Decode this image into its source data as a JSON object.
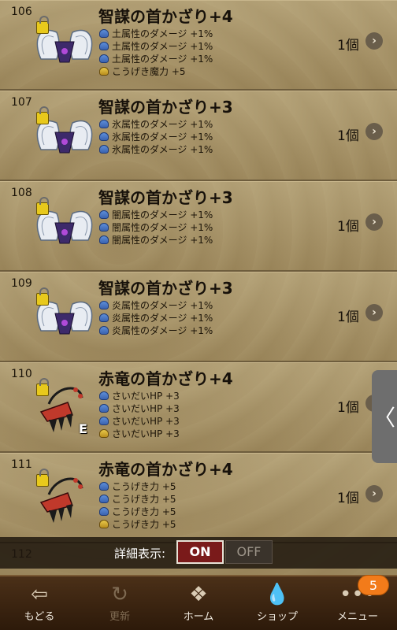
{
  "items": [
    {
      "num": "106",
      "name": "智謀の首かざり+4",
      "type": "wings",
      "equipped": false,
      "stats": [
        {
          "text": "土属性のダメージ +1%",
          "icon": "blue-slime-icon"
        },
        {
          "text": "土属性のダメージ +1%",
          "icon": "blue-slime-icon"
        },
        {
          "text": "土属性のダメージ +1%",
          "icon": "blue-slime-icon"
        },
        {
          "text": "こうげき魔力 +5",
          "icon": "gold-slime-icon"
        }
      ],
      "count": "1個"
    },
    {
      "num": "107",
      "name": "智謀の首かざり+3",
      "type": "wings",
      "equipped": false,
      "stats": [
        {
          "text": "氷属性のダメージ +1%",
          "icon": "blue-slime-icon"
        },
        {
          "text": "氷属性のダメージ +1%",
          "icon": "blue-slime-icon"
        },
        {
          "text": "氷属性のダメージ +1%",
          "icon": "blue-slime-icon"
        }
      ],
      "count": "1個"
    },
    {
      "num": "108",
      "name": "智謀の首かざり+3",
      "type": "wings",
      "equipped": false,
      "stats": [
        {
          "text": "闇属性のダメージ +1%",
          "icon": "blue-slime-icon"
        },
        {
          "text": "闇属性のダメージ +1%",
          "icon": "blue-slime-icon"
        },
        {
          "text": "闇属性のダメージ +1%",
          "icon": "blue-slime-icon"
        }
      ],
      "count": "1個"
    },
    {
      "num": "109",
      "name": "智謀の首かざり+3",
      "type": "wings",
      "equipped": false,
      "stats": [
        {
          "text": "炎属性のダメージ +1%",
          "icon": "blue-slime-icon"
        },
        {
          "text": "炎属性のダメージ +1%",
          "icon": "blue-slime-icon"
        },
        {
          "text": "炎属性のダメージ +1%",
          "icon": "blue-slime-icon"
        }
      ],
      "count": "1個"
    },
    {
      "num": "110",
      "name": "赤竜の首かざり+4",
      "type": "dragon",
      "equipped": true,
      "stats": [
        {
          "text": "さいだいHP +3",
          "icon": "blue-slime-icon"
        },
        {
          "text": "さいだいHP +3",
          "icon": "blue-slime-icon"
        },
        {
          "text": "さいだいHP +3",
          "icon": "blue-slime-icon"
        },
        {
          "text": "さいだいHP +3",
          "icon": "gold-slime-icon"
        }
      ],
      "count": "1個"
    },
    {
      "num": "111",
      "name": "赤竜の首かざり+4",
      "type": "dragon",
      "equipped": false,
      "stats": [
        {
          "text": "こうげき力 +5",
          "icon": "blue-slime-icon"
        },
        {
          "text": "こうげき力 +5",
          "icon": "blue-slime-icon"
        },
        {
          "text": "こうげき力 +5",
          "icon": "blue-slime-icon"
        },
        {
          "text": "こうげき力 +5",
          "icon": "gold-slime-icon"
        }
      ],
      "count": "1個"
    }
  ],
  "partial_item": {
    "num": "112"
  },
  "equip_marker": "E",
  "side_tab": {
    "glyph": "〈",
    "icon": "chevron-left-icon"
  },
  "toggle": {
    "label": "詳細表示:",
    "on": "ON",
    "off": "OFF",
    "active": "ON"
  },
  "nav": {
    "back": {
      "label": "もどる",
      "icon": "arrow-left-icon"
    },
    "refresh": {
      "label": "更新",
      "icon": "refresh-icon"
    },
    "home": {
      "label": "ホーム",
      "icon": "dragon-emblem-icon"
    },
    "shop": {
      "label": "ショップ",
      "icon": "slime-icon"
    },
    "menu": {
      "label": "メニュー",
      "icon": "dots-icon",
      "badge": "5"
    }
  },
  "colors": {
    "background": "#a48f63",
    "toggle_on": "#7a1a1a",
    "badge": "#f27b1a",
    "nav_bg": "#3c2410"
  }
}
